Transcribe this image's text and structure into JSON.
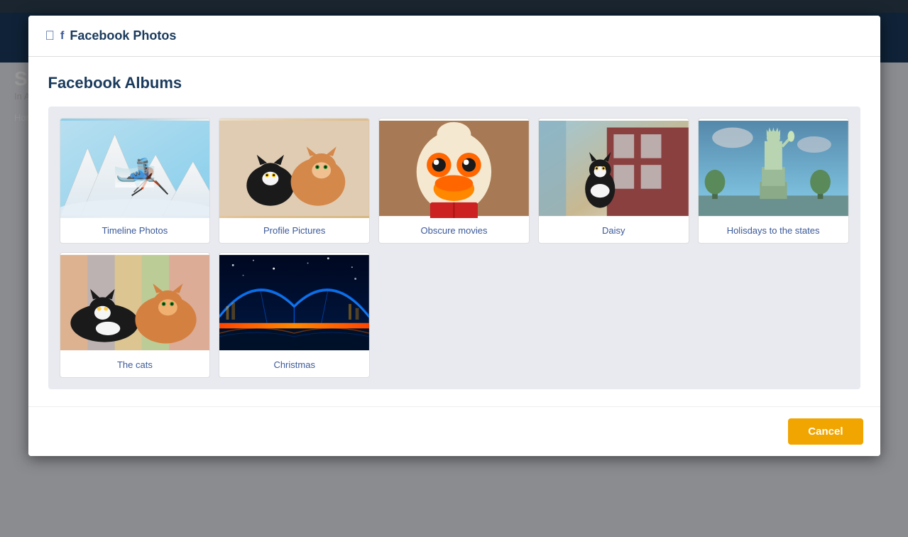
{
  "modal": {
    "header": {
      "facebook_icon": "f",
      "title": "Facebook Photos"
    },
    "albums_title": "Facebook Albums",
    "albums": [
      {
        "id": "timeline",
        "label": "Timeline Photos",
        "thumb_class": "thumb-timeline",
        "emoji": "🎿"
      },
      {
        "id": "profile",
        "label": "Profile Pictures",
        "thumb_class": "thumb-profile",
        "emoji": "🐱"
      },
      {
        "id": "obscure",
        "label": "Obscure movies",
        "thumb_class": "thumb-obscure",
        "emoji": "🦆"
      },
      {
        "id": "daisy",
        "label": "Daisy",
        "thumb_class": "thumb-daisy",
        "emoji": "🐈"
      },
      {
        "id": "holidays",
        "label": "Holisdays to the states",
        "thumb_class": "thumb-holidays",
        "emoji": "🗽"
      },
      {
        "id": "cats",
        "label": "The cats",
        "thumb_class": "thumb-cats",
        "emoji": "🐱"
      },
      {
        "id": "christmas",
        "label": "Christmas",
        "thumb_class": "thumb-christmas",
        "emoji": "🌉"
      }
    ],
    "footer": {
      "cancel_label": "Cancel"
    }
  },
  "background": {
    "title": "Si",
    "subtitle": "In As",
    "nav_link": "Home"
  }
}
